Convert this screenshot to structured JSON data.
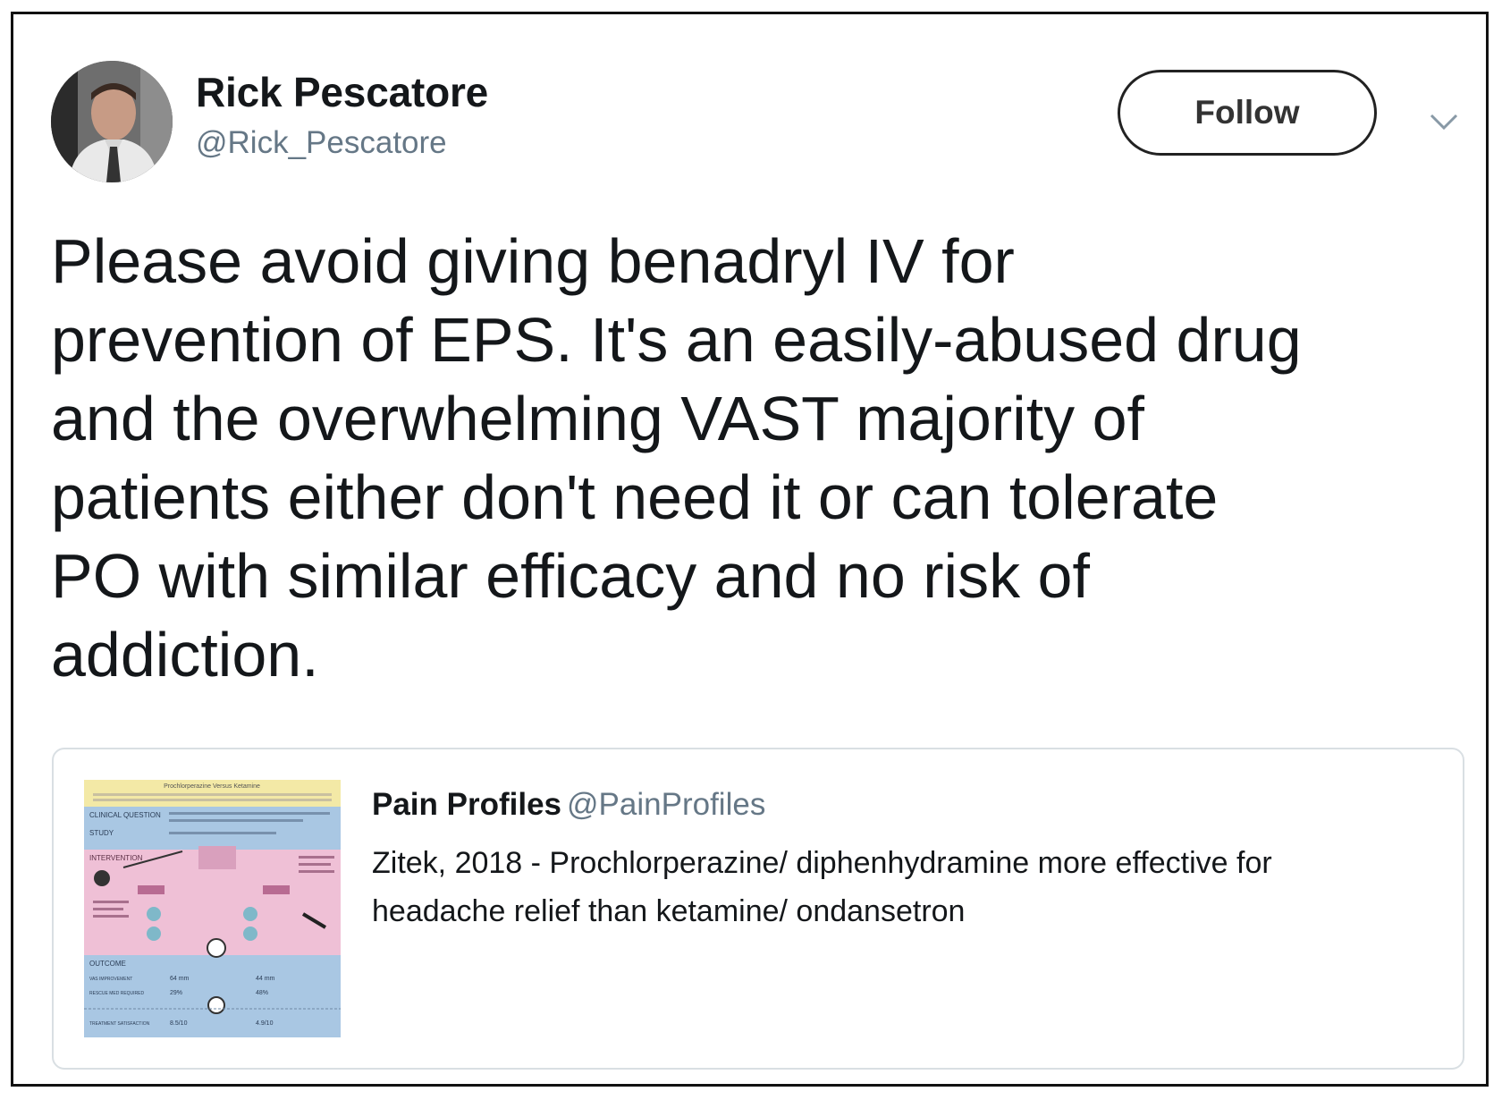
{
  "author": {
    "name": "Rick Pescatore",
    "handle": "@Rick_Pescatore",
    "avatar_icon": "profile-photo"
  },
  "actions": {
    "follow_label": "Follow",
    "menu_icon": "chevron-down-icon"
  },
  "tweet": {
    "lines": [
      "Please avoid giving benadryl IV for",
      "prevention of EPS. It's an easily-abused drug",
      "and the overwhelming VAST majority of",
      "patients either don't need it or can tolerate",
      "PO with similar efficacy and no risk of",
      "addiction."
    ]
  },
  "quoted": {
    "name": "Pain Profiles",
    "handle": "@PainProfiles",
    "text_lines": [
      "Zitek, 2018 - Prochlorperazine/ diphenhydramine more effective for",
      "headache relief than ketamine/ ondansetron"
    ],
    "thumbnail": {
      "title": "Prochlorperazine Versus Ketamine",
      "sections": [
        "CLINICAL QUESTION",
        "STUDY",
        "INTERVENTION",
        "OUTCOME"
      ],
      "rows": [
        "VAS IMPROVEMENT",
        "RESCUE MED REQUIRED",
        "TREATMENT SATISFACTION"
      ],
      "values_left": [
        "64 mm",
        "29%",
        "8.5/10"
      ],
      "values_right": [
        "44 mm",
        "48%",
        "4.9/10"
      ]
    }
  }
}
